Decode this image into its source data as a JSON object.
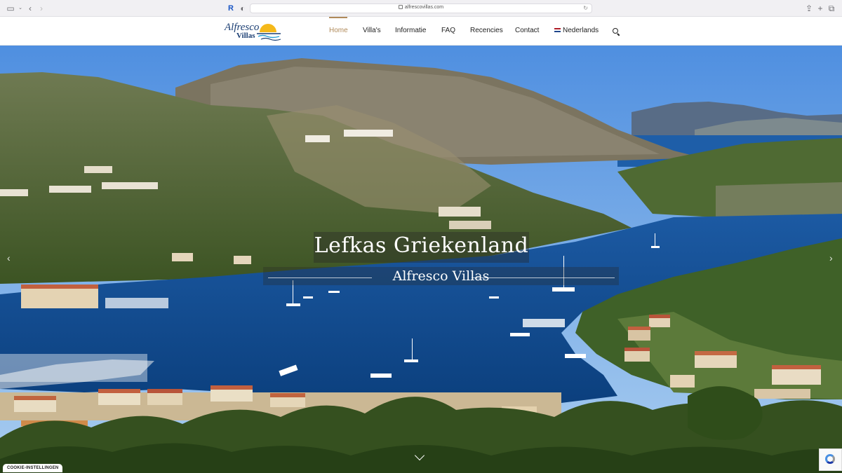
{
  "browser": {
    "url": "alfrescovillas.com"
  },
  "site": {
    "logo": {
      "line1": "Alfresco",
      "line2": "Villas"
    },
    "nav": [
      {
        "label": "Home",
        "active": true
      },
      {
        "label": "Villa's",
        "active": false
      },
      {
        "label": "Informatie",
        "active": false
      },
      {
        "label": "FAQ",
        "active": false
      },
      {
        "label": "Recencies",
        "active": false
      },
      {
        "label": "Contact",
        "active": false
      },
      {
        "label": "Nederlands",
        "active": false
      }
    ]
  },
  "hero": {
    "title": "Lefkas Griekenland",
    "subtitle": "Alfresco Villas"
  },
  "cookie": {
    "label": "COOKIE-INSTELLINGEN"
  },
  "colors": {
    "accent": "#b08a5a",
    "logo_blue": "#1b3e73",
    "sea": "#0f4d8f",
    "sky": "#6aa3df"
  },
  "icons": [
    "sidebar-icon",
    "chevron-left-icon",
    "chevron-right-icon",
    "reader-icon",
    "shield-icon",
    "reload-icon",
    "share-icon",
    "plus-icon",
    "tabs-icon",
    "search-icon",
    "flag-nl-icon",
    "chevron-down-icon",
    "recaptcha-icon"
  ]
}
